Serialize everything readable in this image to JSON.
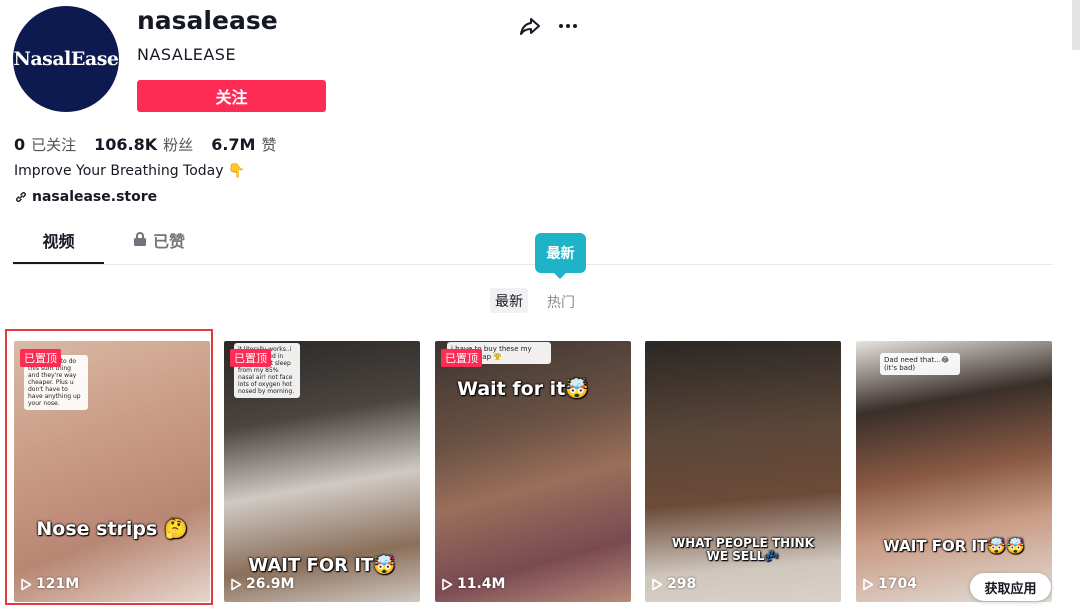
{
  "profile": {
    "avatar_text": "NasalEase",
    "username": "nasalease",
    "nickname": "NASALEASE",
    "follow_label": "关注",
    "stats": [
      {
        "value": "0",
        "label": "已关注"
      },
      {
        "value": "106.8K",
        "label": "粉丝"
      },
      {
        "value": "6.7M",
        "label": "赞"
      }
    ],
    "bio": "Improve Your Breathing Today",
    "bio_emoji": "👇",
    "link": "nasalease.store"
  },
  "tabs": {
    "videos": "视频",
    "liked": "已赞"
  },
  "sort": {
    "tooltip": "最新",
    "latest": "最新",
    "popular": "热门"
  },
  "videos": [
    {
      "pinned": "已置顶",
      "comment": "Pls u have to do this sum thing and they're way cheaper. Plus u don't have to have anything up your nose.",
      "caption": "Nose strips 🤔",
      "views": "121M"
    },
    {
      "pinned": "已置顶",
      "comment": "it literally works..i snorted loud in 2020 to get sleep from my 85% nasal air! not face lots of oxygen hot nosed by morning.",
      "caption": "WAIT FOR IT🤯",
      "views": "26.9M"
    },
    {
      "pinned": "已置顶",
      "comment": "i have to buy these my father asap 😤",
      "caption": "Wait for it🤯",
      "views": "11.4M"
    },
    {
      "pinned": "",
      "comment": "",
      "caption": "WHAT PEOPLE THINK WE SELL💤",
      "views": "298"
    },
    {
      "pinned": "",
      "comment": "Dad need that...😂 (it's bad)",
      "caption": "WAIT FOR IT🤯🤯",
      "views": "1704"
    }
  ],
  "get_app_label": "获取应用",
  "colors": {
    "accent": "#fe2c55",
    "tooltip": "#1fb3c7",
    "avatar_bg": "#0d1a4f"
  }
}
